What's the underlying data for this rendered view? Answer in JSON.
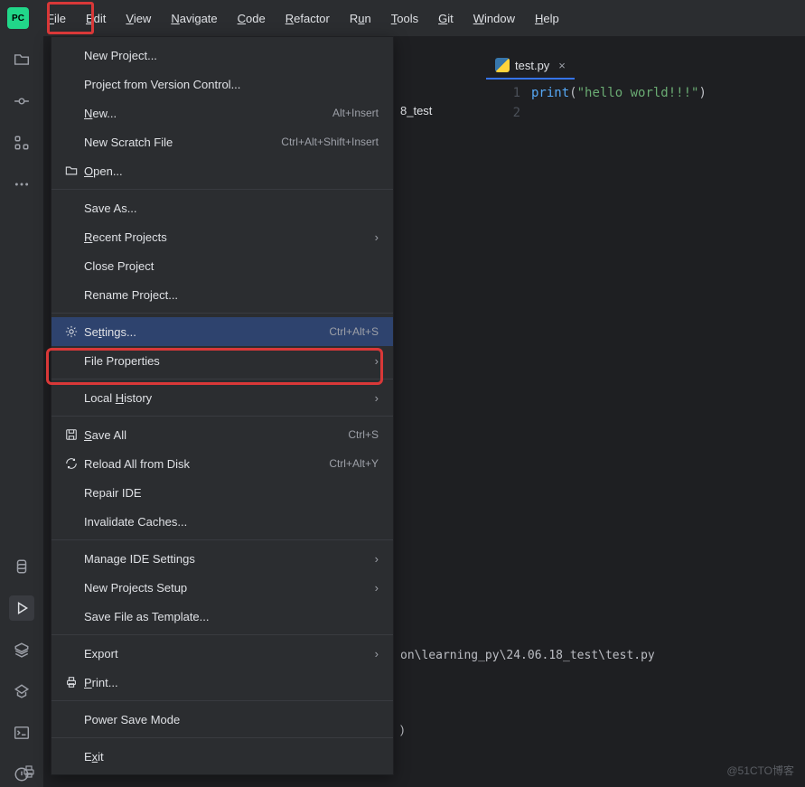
{
  "app": {
    "logo_text": "PC"
  },
  "menubar": {
    "items": [
      {
        "label": "File",
        "mnemonic": "F"
      },
      {
        "label": "Edit",
        "mnemonic": "E"
      },
      {
        "label": "View",
        "mnemonic": "V"
      },
      {
        "label": "Navigate",
        "mnemonic": "N"
      },
      {
        "label": "Code",
        "mnemonic": "C"
      },
      {
        "label": "Refactor",
        "mnemonic": "R"
      },
      {
        "label": "Run",
        "mnemonic": "u"
      },
      {
        "label": "Tools",
        "mnemonic": "T"
      },
      {
        "label": "Git",
        "mnemonic": "G"
      },
      {
        "label": "Window",
        "mnemonic": "W"
      },
      {
        "label": "Help",
        "mnemonic": "H"
      }
    ]
  },
  "file_menu": {
    "items": [
      {
        "label": "New Project...",
        "icon": "",
        "shortcut": "",
        "arrow": false
      },
      {
        "label": "Project from Version Control...",
        "icon": "",
        "shortcut": "",
        "arrow": false
      },
      {
        "label": "New...",
        "mnemonic": "N",
        "icon": "",
        "shortcut": "Alt+Insert",
        "arrow": false
      },
      {
        "label": "New Scratch File",
        "icon": "",
        "shortcut": "Ctrl+Alt+Shift+Insert",
        "arrow": false
      },
      {
        "label": "Open...",
        "mnemonic": "O",
        "icon": "folder",
        "shortcut": "",
        "arrow": false,
        "sep_after": true
      },
      {
        "label": "Save As...",
        "icon": "",
        "shortcut": "",
        "arrow": false
      },
      {
        "label": "Recent Projects",
        "mnemonic": "R",
        "icon": "",
        "shortcut": "",
        "arrow": true
      },
      {
        "label": "Close Project",
        "icon": "",
        "shortcut": "",
        "arrow": false
      },
      {
        "label": "Rename Project...",
        "icon": "",
        "shortcut": "",
        "arrow": false,
        "sep_after": true
      },
      {
        "label": "Settings...",
        "mnemonic": "t",
        "icon": "gear",
        "shortcut": "Ctrl+Alt+S",
        "arrow": false,
        "selected": true
      },
      {
        "label": "File Properties",
        "icon": "",
        "shortcut": "",
        "arrow": true,
        "sep_after": true
      },
      {
        "label": "Local History",
        "mnemonic": "H",
        "icon": "",
        "shortcut": "",
        "arrow": true,
        "sep_after": true
      },
      {
        "label": "Save All",
        "mnemonic": "S",
        "icon": "save",
        "shortcut": "Ctrl+S",
        "arrow": false
      },
      {
        "label": "Reload All from Disk",
        "icon": "reload",
        "shortcut": "Ctrl+Alt+Y",
        "arrow": false
      },
      {
        "label": "Repair IDE",
        "icon": "",
        "shortcut": "",
        "arrow": false
      },
      {
        "label": "Invalidate Caches...",
        "icon": "",
        "shortcut": "",
        "arrow": false,
        "sep_after": true
      },
      {
        "label": "Manage IDE Settings",
        "icon": "",
        "shortcut": "",
        "arrow": true
      },
      {
        "label": "New Projects Setup",
        "icon": "",
        "shortcut": "",
        "arrow": true
      },
      {
        "label": "Save File as Template...",
        "icon": "",
        "shortcut": "",
        "arrow": false,
        "sep_after": true
      },
      {
        "label": "Export",
        "icon": "",
        "shortcut": "",
        "arrow": true
      },
      {
        "label": "Print...",
        "mnemonic": "P",
        "icon": "print",
        "shortcut": "",
        "arrow": false,
        "sep_after": true
      },
      {
        "label": "Power Save Mode",
        "icon": "",
        "shortcut": "",
        "arrow": false,
        "sep_after": true
      },
      {
        "label": "Exit",
        "mnemonic": "x",
        "icon": "",
        "shortcut": "",
        "arrow": false
      }
    ]
  },
  "project": {
    "visible_name_fragment": "8_test"
  },
  "editor": {
    "tab_name": "test.py",
    "lines": [
      "1",
      "2"
    ],
    "code_fn": "print",
    "code_str": "\"hello world!!!\""
  },
  "console": {
    "path_fragment": "on\\learning_py\\24.06.18_test\\test.py",
    "exit_fragment": ")"
  },
  "watermark": "@51CTO博客"
}
